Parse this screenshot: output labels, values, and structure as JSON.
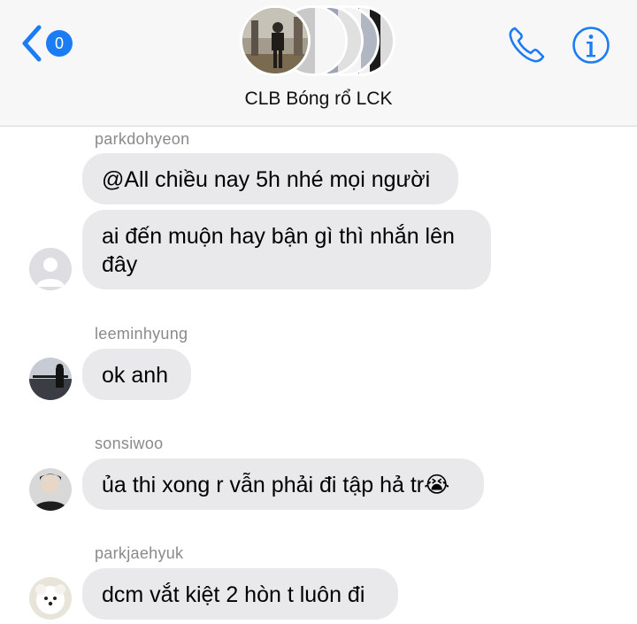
{
  "header": {
    "unread_count": "0",
    "group_name": "CLB Bóng rổ LCK",
    "icons": [
      "back-chevron-icon",
      "phone-icon",
      "info-icon"
    ],
    "accent_color": "#1c7cf4"
  },
  "messages": [
    {
      "sender": "parkdohyeon",
      "bubbles": [
        "@All chiều nay 5h nhé mọi người",
        "ai đến muộn hay bận gì thì nhắn lên đây"
      ],
      "avatar": "default-avatar"
    },
    {
      "sender": "leeminhyung",
      "bubbles": [
        "ok anh"
      ],
      "avatar": "user-photo-avatar"
    },
    {
      "sender": "sonsiwoo",
      "bubbles": [
        "ủa thi xong r vẫn phải đi tập hả tr😭"
      ],
      "avatar": "user-photo-avatar"
    },
    {
      "sender": "parkjaehyuk",
      "bubbles": [
        "dcm vắt kiệt 2 hòn t luôn đi"
      ],
      "avatar": "dog-photo-avatar"
    }
  ],
  "bubble_color": "#e9e9eb"
}
